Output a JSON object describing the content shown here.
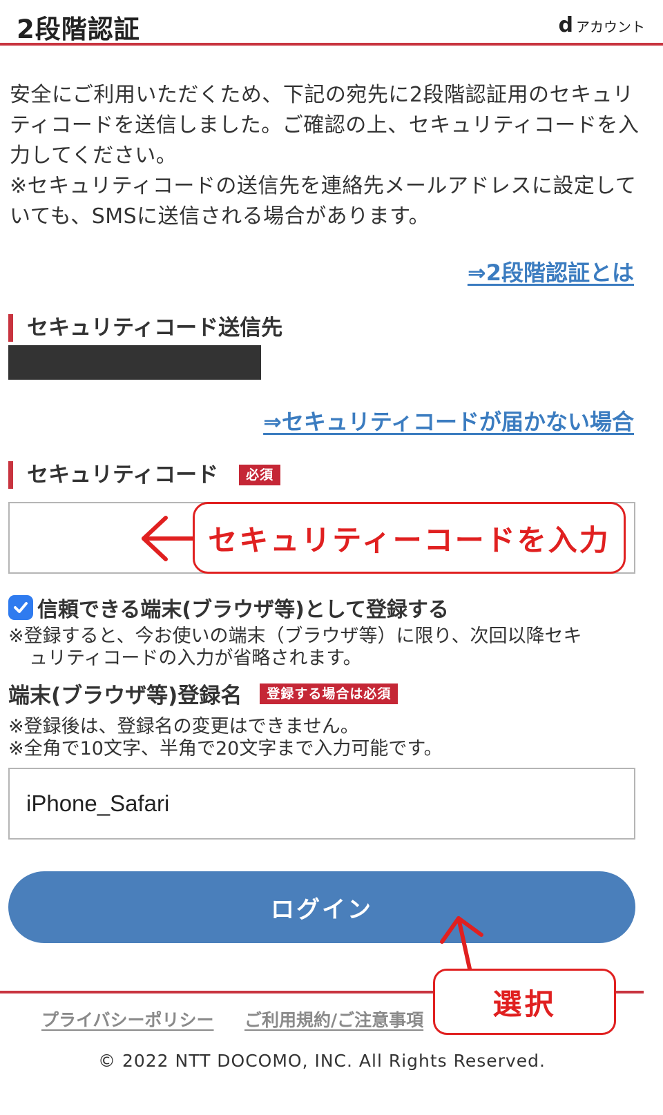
{
  "header": {
    "title": "2段階認証",
    "brand_mark": "d",
    "brand_text": "アカウント"
  },
  "intro": {
    "paragraph1": "安全にご利用いただくため、下記の宛先に2段階認証用のセキュリティコードを送信しました。ご確認の上、セキュリティコードを入力してください。",
    "paragraph2": "※セキュリティコードの送信先を連絡先メールアドレスに設定していても、SMSに送信される場合があります。"
  },
  "links": {
    "about_2fa": "⇒2段階認証とは",
    "code_not_received": "⇒セキュリティコードが届かない場合"
  },
  "destination": {
    "title": "セキュリティコード送信先"
  },
  "security_code": {
    "title": "セキュリティコード",
    "required_badge": "必須",
    "value": ""
  },
  "trusted_device": {
    "label": "信頼できる端末(ブラウザ等)として登録する",
    "checked": true,
    "note_line1": "※登録すると、今お使いの端末（ブラウザ等）に限り、次回以降セキ",
    "note_line2": "ュリティコードの入力が省略されます。"
  },
  "device_name": {
    "label": "端末(ブラウザ等)登録名",
    "required_badge": "登録する場合は必須",
    "note_line1": "※登録後は、登録名の変更はできません。",
    "note_line2": "※全角で10文字、半角で20文字まで入力可能です。",
    "value": "iPhone_Safari"
  },
  "login_button": {
    "label": "ログイン"
  },
  "footer": {
    "privacy_policy": "プライバシーポリシー",
    "terms": "ご利用規約/ご注意事項",
    "copyright": "© 2022 NTT DOCOMO, INC. All Rights Reserved."
  },
  "annotations": {
    "input_callout": "セキュリティーコードを入力",
    "select_callout": "選択",
    "color": "#e02020"
  },
  "colors": {
    "accent_red": "#c8343f",
    "link_blue": "#3b7cc0",
    "button_blue": "#4a7fbb",
    "checkbox_blue": "#2f7bef"
  }
}
